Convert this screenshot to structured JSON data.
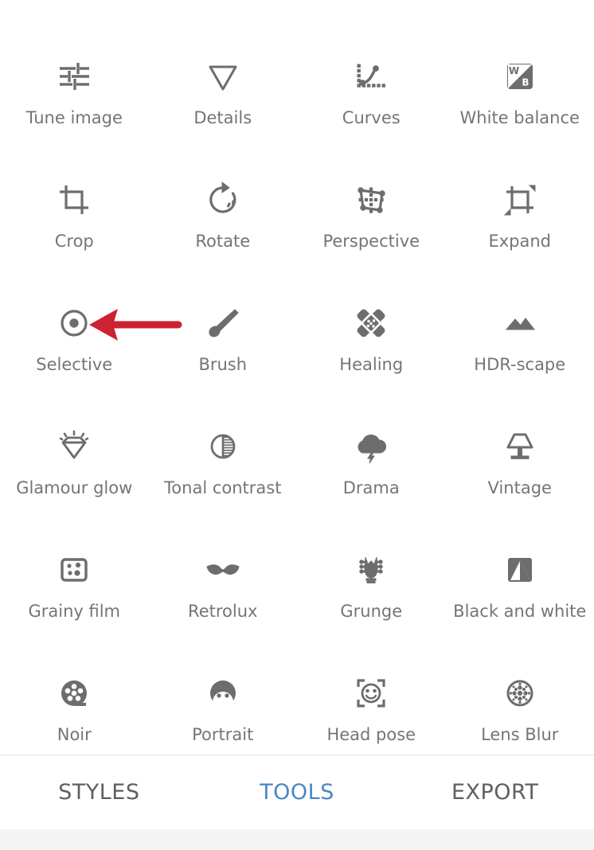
{
  "app": {
    "screen_background": "#ffffff",
    "icon_color": "#6d6d6d",
    "label_color": "#757575",
    "active_tab_color": "#4a86c8",
    "annotation_color": "#cc2233"
  },
  "tools": {
    "items": [
      {
        "label": "Tune image",
        "icon": "tune-image-icon"
      },
      {
        "label": "Details",
        "icon": "details-icon"
      },
      {
        "label": "Curves",
        "icon": "curves-icon"
      },
      {
        "label": "White balance",
        "icon": "white-balance-icon"
      },
      {
        "label": "Crop",
        "icon": "crop-icon"
      },
      {
        "label": "Rotate",
        "icon": "rotate-icon"
      },
      {
        "label": "Perspective",
        "icon": "perspective-icon"
      },
      {
        "label": "Expand",
        "icon": "expand-icon"
      },
      {
        "label": "Selective",
        "icon": "selective-icon"
      },
      {
        "label": "Brush",
        "icon": "brush-icon"
      },
      {
        "label": "Healing",
        "icon": "healing-icon"
      },
      {
        "label": "HDR-scape",
        "icon": "hdr-scape-icon"
      },
      {
        "label": "Glamour glow",
        "icon": "glamour-glow-icon"
      },
      {
        "label": "Tonal contrast",
        "icon": "tonal-contrast-icon"
      },
      {
        "label": "Drama",
        "icon": "drama-icon"
      },
      {
        "label": "Vintage",
        "icon": "vintage-icon"
      },
      {
        "label": "Grainy film",
        "icon": "grainy-film-icon"
      },
      {
        "label": "Retrolux",
        "icon": "retrolux-icon"
      },
      {
        "label": "Grunge",
        "icon": "grunge-icon"
      },
      {
        "label": "Black and white",
        "icon": "black-and-white-icon"
      },
      {
        "label": "Noir",
        "icon": "noir-icon"
      },
      {
        "label": "Portrait",
        "icon": "portrait-icon"
      },
      {
        "label": "Head pose",
        "icon": "head-pose-icon"
      },
      {
        "label": "Lens Blur",
        "icon": "lens-blur-icon"
      }
    ]
  },
  "white_balance_icon": {
    "top_letter": "W",
    "bottom_letter": "B"
  },
  "tabbar": {
    "tabs": [
      {
        "label": "STYLES",
        "active": false
      },
      {
        "label": "TOOLS",
        "active": true
      },
      {
        "label": "EXPORT",
        "active": false
      }
    ]
  },
  "annotation": {
    "type": "arrow",
    "points_to": "Selective",
    "direction": "left",
    "color": "#cc2233"
  }
}
